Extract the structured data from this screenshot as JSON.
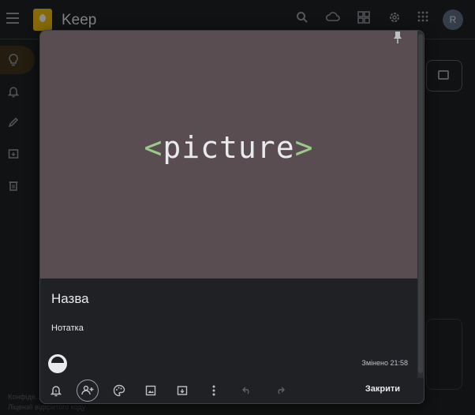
{
  "app": {
    "title": "Keep",
    "avatar_letter": "R",
    "footer_lines": [
      "Конфіде…",
      "Ліцензії відкритого коду"
    ]
  },
  "note_dialog": {
    "image_text": {
      "open": "<",
      "word": "picture",
      "close": ">"
    },
    "title_placeholder": "Назва",
    "note_placeholder": "Нотатка",
    "edited_label": "Змінено 21:58",
    "close_label": "Закрити",
    "toolbar_icons": [
      "reminder-icon",
      "collaborator-icon",
      "palette-icon",
      "image-icon",
      "archive-icon",
      "more-icon",
      "undo-icon",
      "redo-icon"
    ]
  },
  "colors": {
    "background": "#202124",
    "image_bg": "#5a4d52",
    "bracket": "#9bc98a",
    "logo": "#f4c20d"
  }
}
